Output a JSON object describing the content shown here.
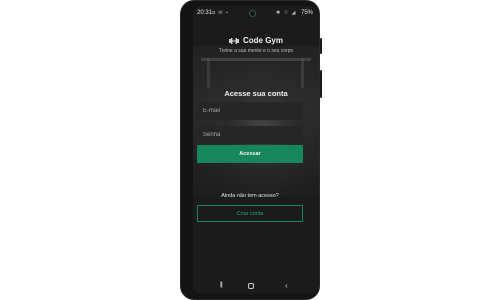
{
  "status_bar": {
    "time": "20:31",
    "left_icons": "◘ ✉ ▪",
    "right_icons": "✱ ⌔ ◢",
    "battery": "75%"
  },
  "brand": {
    "name": "Code Gym",
    "tagline": "Treine a sua mente e o seu corpo",
    "accent_color": "#17865c"
  },
  "login": {
    "title": "Acesse sua conta",
    "email_placeholder": "E-mail",
    "password_placeholder": "Senha",
    "submit_label": "Acessar"
  },
  "signup": {
    "prompt": "Ainda não tem acesso?",
    "button_label": "Criar conta"
  },
  "nav": {
    "recents_icon": "recents-icon",
    "home_icon": "home-icon",
    "back_icon": "back-icon"
  }
}
